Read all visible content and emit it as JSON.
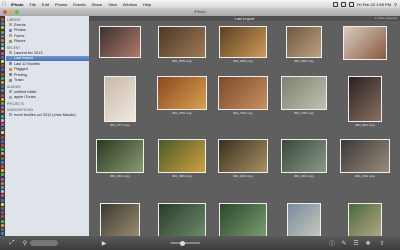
{
  "menubar": {
    "app": "iPhoto",
    "items": [
      "File",
      "Edit",
      "Photos",
      "Events",
      "Share",
      "View",
      "Window",
      "Help"
    ],
    "clock": "Fri Feb 22 1:59 PM"
  },
  "window_title": "iPhoto",
  "event_title": "Last Import",
  "photo_count": "1 photo selected",
  "sidebar": {
    "sections": [
      {
        "title": "LIBRARY",
        "items": [
          {
            "label": "Events",
            "color": "#c7a26a",
            "icon": "events-icon"
          },
          {
            "label": "Photos",
            "color": "#6b8fc2",
            "icon": "photos-icon"
          },
          {
            "label": "Faces",
            "color": "#c49a7a",
            "icon": "faces-icon"
          },
          {
            "label": "Places",
            "color": "#7fa36b",
            "icon": "places-icon"
          }
        ]
      },
      {
        "title": "RECENT",
        "items": [
          {
            "label": "Laurent fev 2013",
            "color": "#c7a26a",
            "icon": "event-icon"
          },
          {
            "label": "Last Import",
            "color": "#6b8fc2",
            "icon": "import-icon",
            "selected": true
          },
          {
            "label": "Last 12 Months",
            "color": "#8c7fc2",
            "icon": "calendar-icon"
          },
          {
            "label": "Flagged",
            "color": "#d9853b",
            "icon": "flag-icon"
          },
          {
            "label": "Printing",
            "color": "#8a8a8a",
            "icon": "printer-icon"
          },
          {
            "label": "Trash",
            "color": "#8a8a8a",
            "icon": "trash-icon"
          }
        ]
      },
      {
        "title": "ALBUMS",
        "items": [
          {
            "label": "untitled folder",
            "color": "#9aa6b6",
            "icon": "folder-icon"
          },
          {
            "label": "apple iTunes",
            "color": "#9aa6b6",
            "icon": "album-icon"
          }
        ]
      },
      {
        "title": "PROJECTS",
        "items": []
      },
      {
        "title": "SUBSCRIPTIONS",
        "items": [
          {
            "label": "excel feuilles oct 2012 (chez Maude)",
            "color": "#9aa6b6",
            "icon": "album-icon"
          }
        ]
      }
    ]
  },
  "photos": [
    {
      "caption": "",
      "colors": [
        "#3a3230",
        "#b07a6a"
      ]
    },
    {
      "caption": "IMG_3591 copy",
      "colors": [
        "#4a3a2a",
        "#a07850"
      ]
    },
    {
      "caption": "IMG_3591 copy",
      "colors": [
        "#5a4020",
        "#d09a5a"
      ]
    },
    {
      "caption": "IMG_3591 copy",
      "colors": [
        "#6a5a40",
        "#c0a080"
      ]
    },
    {
      "caption": "",
      "colors": [
        "#d8ccc0",
        "#8a5a40"
      ]
    },
    {
      "caption": "IMG_3771 copy",
      "colors": [
        "#c8b8a8",
        "#f0e8e0"
      ]
    },
    {
      "caption": "IMG_3781 copy",
      "colors": [
        "#8a4a20",
        "#d8a050"
      ]
    },
    {
      "caption": "IMG_3781 copy",
      "colors": [
        "#7a4a2a",
        "#c89060"
      ]
    },
    {
      "caption": "IMG_3781 copy",
      "colors": [
        "#808070",
        "#c0c0b0"
      ]
    },
    {
      "caption": "IMG_3911 copy",
      "colors": [
        "#2a2020",
        "#8a7060"
      ]
    },
    {
      "caption": "IMG_3931 copy",
      "colors": [
        "#2a3a20",
        "#8a9a70"
      ]
    },
    {
      "caption": "IMG_3981 copy",
      "colors": [
        "#4a5a2a",
        "#d0a040"
      ]
    },
    {
      "caption": "IMG_4031 copy",
      "colors": [
        "#3a3020",
        "#a89060"
      ]
    },
    {
      "caption": "IMG_4031 copy",
      "colors": [
        "#3a4a3a",
        "#8a9a8a"
      ]
    },
    {
      "caption": "IMG_4041 copy",
      "colors": [
        "#3a3a3a",
        "#9a8a7a"
      ]
    },
    {
      "caption": "",
      "colors": [
        "#3a3a30",
        "#9a8a70"
      ]
    },
    {
      "caption": "",
      "colors": [
        "#2a3a2a",
        "#6a8a6a"
      ]
    },
    {
      "caption": "",
      "colors": [
        "#2a4a2a",
        "#7a9a70"
      ]
    },
    {
      "caption": "",
      "colors": [
        "#7a8aa0",
        "#d0d0c0"
      ]
    },
    {
      "caption": "",
      "colors": [
        "#4a6a3a",
        "#c0b090"
      ]
    }
  ],
  "toolbar": {
    "search_placeholder": "Search"
  }
}
